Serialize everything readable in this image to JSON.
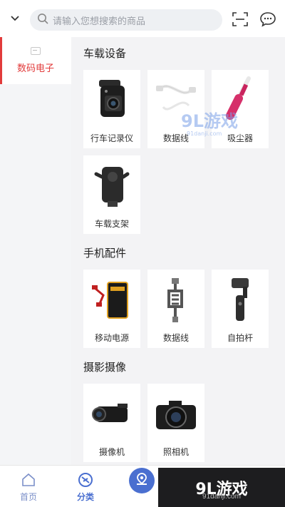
{
  "header": {
    "search_placeholder": "请输入您想搜索的商品"
  },
  "sidebar": {
    "items": [
      {
        "label": "数码电子"
      }
    ]
  },
  "sections": [
    {
      "title": "车载设备",
      "products": [
        {
          "name": "行车记录仪"
        },
        {
          "name": "数据线"
        },
        {
          "name": "吸尘器"
        },
        {
          "name": "车载支架"
        }
      ]
    },
    {
      "title": "手机配件",
      "products": [
        {
          "name": "移动电源"
        },
        {
          "name": "数据线"
        },
        {
          "name": "自拍杆"
        }
      ]
    },
    {
      "title": "摄影摄像",
      "products": [
        {
          "name": "摄像机"
        },
        {
          "name": "照相机"
        }
      ]
    }
  ],
  "bottom_nav": {
    "home": "首页",
    "category": "分类"
  },
  "watermark": {
    "text": "9L游戏",
    "url": "91danji.com"
  },
  "colors": {
    "accent": "#e23b3b",
    "brand_blue": "#4a6fd0"
  }
}
